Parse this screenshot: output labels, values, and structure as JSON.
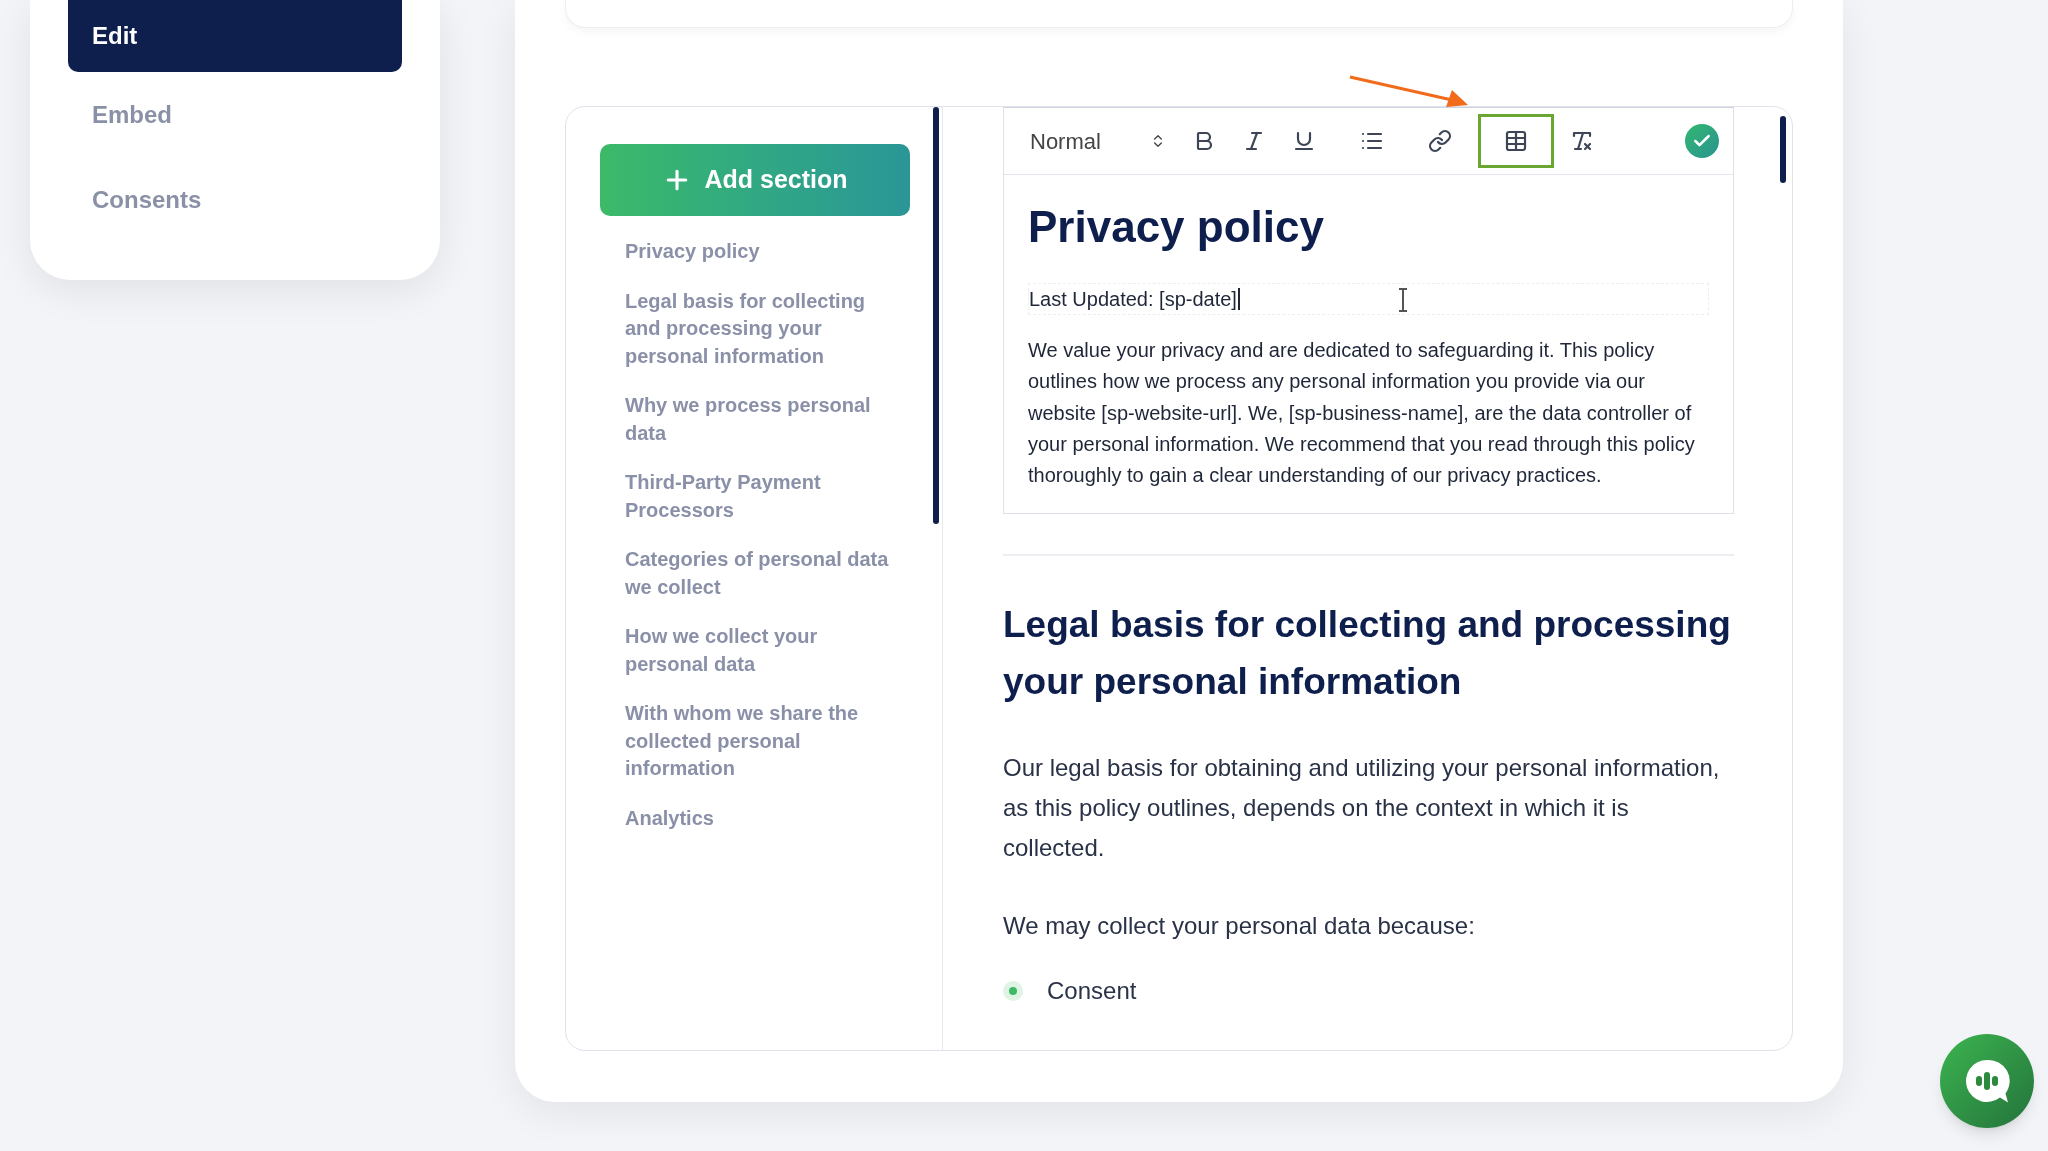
{
  "sidebar": {
    "items": [
      {
        "label": "Edit",
        "selected": true
      },
      {
        "label": "Embed",
        "selected": false
      },
      {
        "label": "Consents",
        "selected": false
      }
    ]
  },
  "sections": {
    "add_button": "Add section",
    "items": [
      {
        "label": "Privacy policy"
      },
      {
        "label": "Legal basis for collecting and processing your personal information"
      },
      {
        "label": "Why we process personal data"
      },
      {
        "label": "Third-Party Payment Processors"
      },
      {
        "label": "Categories of personal data we collect"
      },
      {
        "label": "How we collect your personal data"
      },
      {
        "label": "With whom we share the collected personal information"
      },
      {
        "label": "Analytics"
      }
    ]
  },
  "editor": {
    "format": "Normal",
    "toolbar": [
      {
        "kind": "bold",
        "highlighted": false
      },
      {
        "kind": "italic",
        "highlighted": false
      },
      {
        "kind": "underline",
        "highlighted": false
      },
      {
        "kind": "list",
        "highlighted": false
      },
      {
        "kind": "link",
        "highlighted": false
      },
      {
        "kind": "table",
        "highlighted": true
      },
      {
        "kind": "clear",
        "highlighted": false
      }
    ],
    "title": "Privacy policy",
    "last_updated": "Last Updated: [sp-date]",
    "intro": "We value your privacy and are dedicated to safeguarding it. This policy outlines how we process any personal information you provide via our website [sp-website-url]. We, [sp-business-name], are the data controller of your personal information. We recommend that you read through this policy thoroughly to gain a clear understanding of our privacy practices."
  },
  "content": {
    "heading": "Legal basis for collecting and processing your personal information",
    "paragraphs": [
      "Our legal basis for obtaining and utilizing your personal information, as this policy outlines, depends on the context in which it is collected.",
      "We may collect your personal data because:"
    ],
    "bullets": [
      {
        "label": "Consent"
      }
    ]
  }
}
